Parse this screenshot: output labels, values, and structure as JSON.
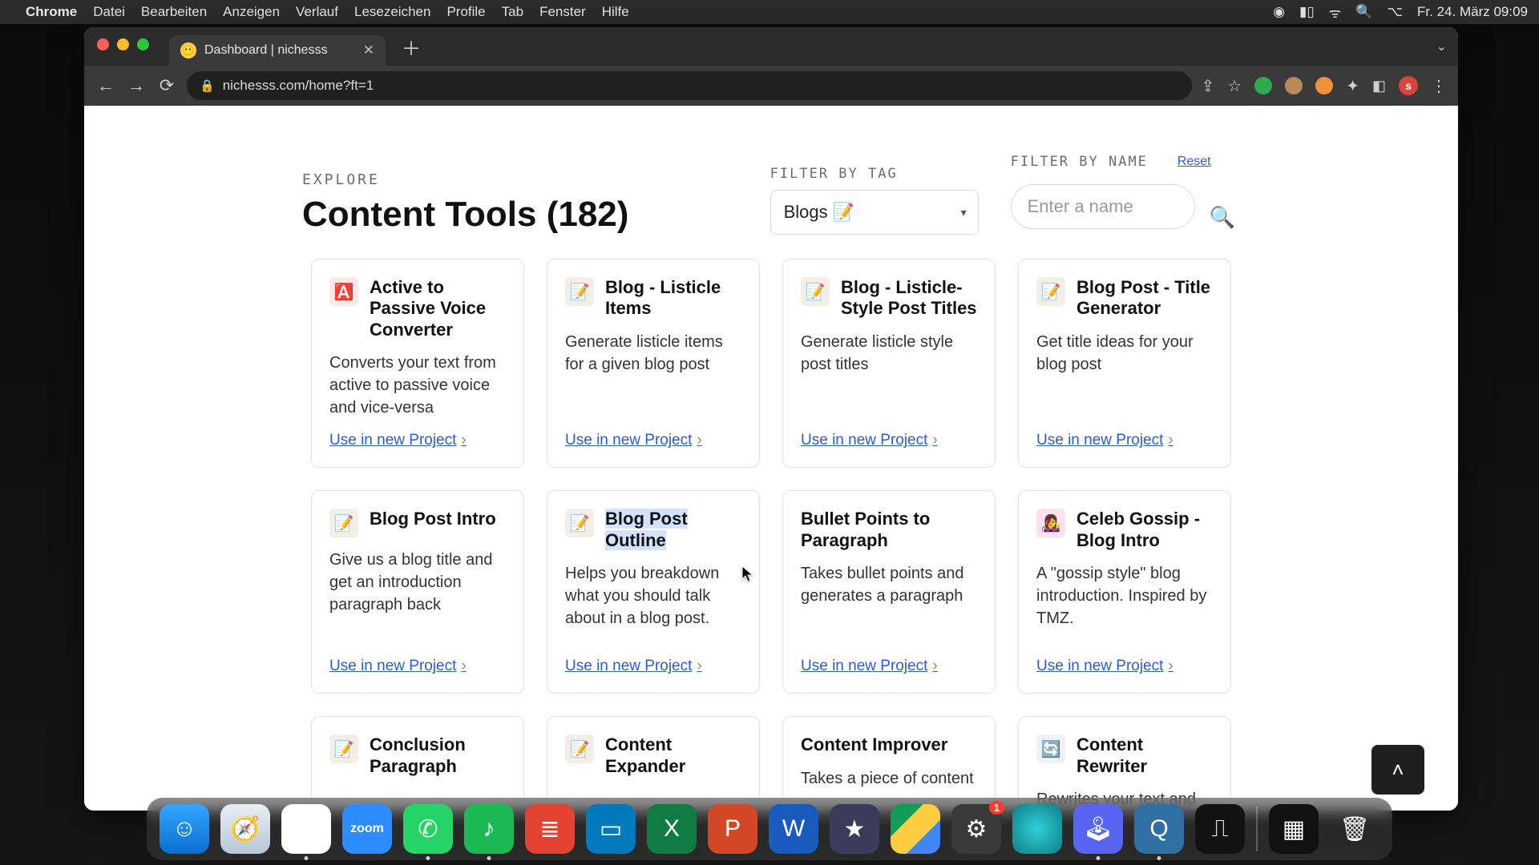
{
  "menubar": {
    "app": "Chrome",
    "items": [
      "Datei",
      "Bearbeiten",
      "Anzeigen",
      "Verlauf",
      "Lesezeichen",
      "Profile",
      "Tab",
      "Fenster",
      "Hilfe"
    ],
    "clock": "Fr. 24. März  09:09"
  },
  "browser": {
    "tab_title": "Dashboard | nichesss",
    "url": "nichesss.com/home?ft=1",
    "avatar_letter": "s"
  },
  "page": {
    "explore": "EXPLORE",
    "title": "Content Tools (182)",
    "filter_tag_label": "FILTER BY TAG",
    "tag_value": "Blogs 📝",
    "filter_name_label": "FILTER BY NAME",
    "reset": "Reset",
    "name_placeholder": "Enter a name",
    "use_link": "Use in new Project"
  },
  "cards": [
    {
      "icon": "🅰️",
      "icon_bg": "#ffe8e8",
      "title": "Active to Passive Voice Converter",
      "desc": "Converts your text from active to passive voice and vice-versa"
    },
    {
      "icon": "📝",
      "icon_bg": "#f4eee6",
      "title": "Blog - Listicle Items",
      "desc": "Generate listicle items for a given blog post"
    },
    {
      "icon": "📝",
      "icon_bg": "#f4eee6",
      "title": "Blog - Listicle-Style Post Titles",
      "desc": "Generate listicle style post titles"
    },
    {
      "icon": "📝",
      "icon_bg": "#f4eee6",
      "title": "Blog Post - Title Generator",
      "desc": "Get title ideas for your blog post"
    },
    {
      "icon": "📝",
      "icon_bg": "#f4eee6",
      "title": "Blog Post Intro",
      "desc": "Give us a blog title and get an introduction paragraph back"
    },
    {
      "icon": "📝",
      "icon_bg": "#f4eee6",
      "title": "Blog Post Outline",
      "desc": "Helps you breakdown what you should talk about in a blog post.",
      "highlight": true
    },
    {
      "icon": "",
      "icon_bg": "transparent",
      "title": "Bullet Points to Paragraph",
      "desc": "Takes bullet points and generates a paragraph"
    },
    {
      "icon": "👩‍🎤",
      "icon_bg": "#ffe0ef",
      "title": "Celeb Gossip - Blog Intro",
      "desc": "A \"gossip style\" blog introduction. Inspired by TMZ."
    },
    {
      "icon": "📝",
      "icon_bg": "#f4eee6",
      "title": "Conclusion Paragraph",
      "desc": ""
    },
    {
      "icon": "📝",
      "icon_bg": "#f4eee6",
      "title": "Content Expander",
      "desc": ""
    },
    {
      "icon": "",
      "icon_bg": "transparent",
      "title": "Content Improver",
      "desc": "Takes a piece of content"
    },
    {
      "icon": "🔄",
      "icon_bg": "#eef1f5",
      "title": "Content Rewriter",
      "desc": "Rewrites your text and"
    }
  ],
  "dock": {
    "apps": [
      {
        "name": "finder",
        "bg": "linear-gradient(#35a6ff,#0a6ed1)",
        "glyph": "☺"
      },
      {
        "name": "safari",
        "bg": "linear-gradient(#e9eef4,#b9c6d6)",
        "glyph": "🧭"
      },
      {
        "name": "chrome",
        "bg": "#fff",
        "glyph": "◉",
        "running": true
      },
      {
        "name": "zoom",
        "bg": "#2d8cff",
        "glyph": "zoom",
        "text": true
      },
      {
        "name": "whatsapp",
        "bg": "#25d366",
        "glyph": "✆",
        "running": true
      },
      {
        "name": "spotify",
        "bg": "#1db954",
        "glyph": "♪",
        "running": true
      },
      {
        "name": "todoist",
        "bg": "#e44332",
        "glyph": "≣"
      },
      {
        "name": "trello",
        "bg": "#0079bf",
        "glyph": "▭"
      },
      {
        "name": "excel",
        "bg": "#107c41",
        "glyph": "X"
      },
      {
        "name": "powerpoint",
        "bg": "#d24726",
        "glyph": "P"
      },
      {
        "name": "word",
        "bg": "#185abd",
        "glyph": "W"
      },
      {
        "name": "imovie",
        "bg": "#3b3b5b",
        "glyph": "★"
      },
      {
        "name": "drive",
        "bg": "linear-gradient(135deg,#0f9d58 33%,#ffcd40 33% 66%,#4285f4 66%)",
        "glyph": ""
      },
      {
        "name": "settings",
        "bg": "#3a3a3a",
        "glyph": "⚙",
        "badge": "1"
      },
      {
        "name": "siri",
        "bg": "radial-gradient(circle,#30d0d8,#0e7d86)",
        "glyph": ""
      },
      {
        "name": "discord",
        "bg": "#5865f2",
        "glyph": "🕹",
        "running": true
      },
      {
        "name": "quicktime",
        "bg": "#2f6fa3",
        "glyph": "Q",
        "running": true
      },
      {
        "name": "voice-memos",
        "bg": "#121212",
        "glyph": "⎍"
      }
    ],
    "end": [
      {
        "name": "mission-control",
        "bg": "#111",
        "glyph": "▦"
      },
      {
        "name": "trash",
        "bg": "transparent",
        "glyph": "🗑"
      }
    ]
  }
}
